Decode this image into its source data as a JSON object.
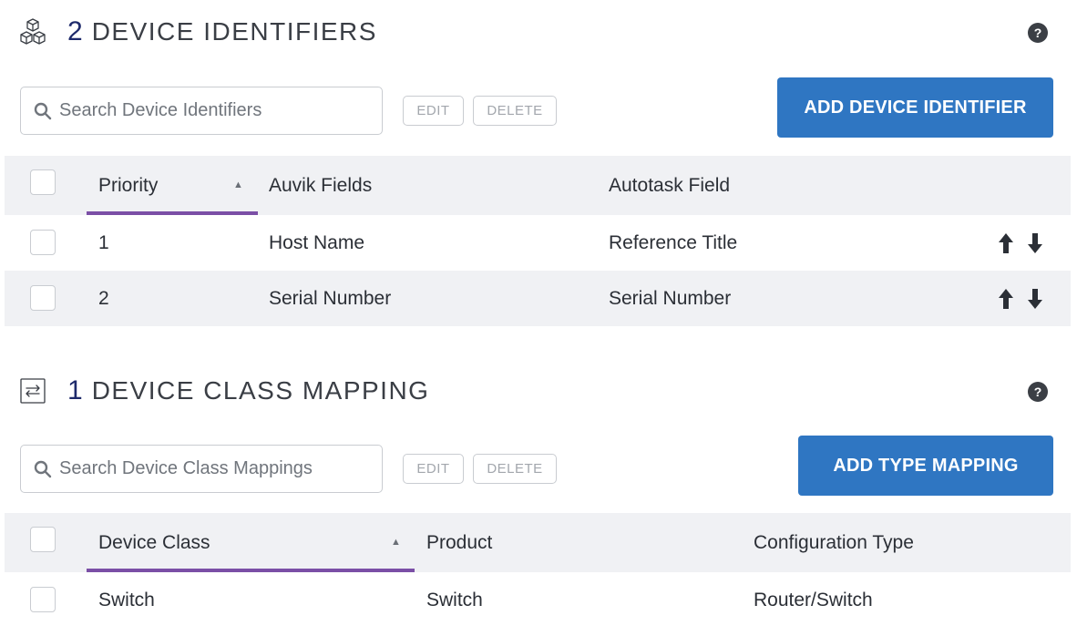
{
  "device_identifiers": {
    "count": "2",
    "title": "DEVICE IDENTIFIERS",
    "help_label": "?",
    "search_placeholder": "Search Device Identifiers",
    "edit_label": "EDIT",
    "delete_label": "DELETE",
    "add_label": "ADD DEVICE IDENTIFIER",
    "columns": {
      "priority": "Priority",
      "auvik_fields": "Auvik Fields",
      "autotask_field": "Autotask Field"
    },
    "rows": [
      {
        "priority": "1",
        "auvik_field": "Host Name",
        "autotask_field": "Reference Title"
      },
      {
        "priority": "2",
        "auvik_field": "Serial Number",
        "autotask_field": "Serial Number"
      }
    ]
  },
  "device_class_mapping": {
    "count": "1",
    "title": "DEVICE CLASS MAPPING",
    "help_label": "?",
    "search_placeholder": "Search Device Class Mappings",
    "edit_label": "EDIT",
    "delete_label": "DELETE",
    "add_label": "ADD TYPE MAPPING",
    "columns": {
      "device_class": "Device Class",
      "product": "Product",
      "configuration_type": "Configuration Type"
    },
    "rows": [
      {
        "device_class": "Switch",
        "product": "Switch",
        "configuration_type": "Router/Switch"
      }
    ]
  },
  "icons": {
    "identifiers_icon": "cubes-icon",
    "mapping_icon": "swap-arrows-icon",
    "search_icon": "search-icon",
    "sort_icon": "sort-up-icon",
    "move_up_icon": "arrow-up-icon",
    "move_down_icon": "arrow-down-icon"
  },
  "colors": {
    "primary_button": "#2f76c2",
    "count_text": "#1e2a6b",
    "sort_underline": "#7b4fa6",
    "table_header_bg": "#f0f1f4"
  }
}
